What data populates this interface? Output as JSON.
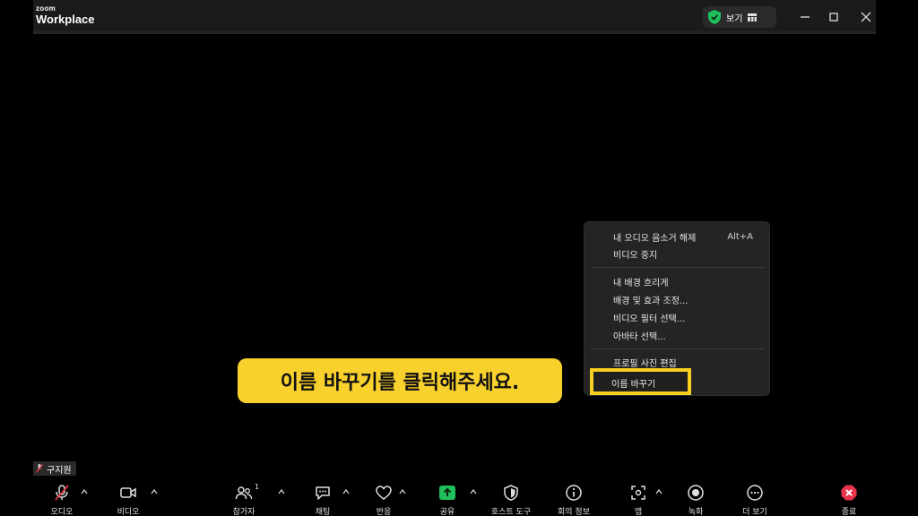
{
  "titlebar": {
    "logo_small": "zoom",
    "logo_big": "Workplace",
    "view_label": "보기",
    "icons": [
      "shield-check-icon",
      "grid-icon",
      "minimize-icon",
      "maximize-icon",
      "close-icon"
    ],
    "shield_color": "#1fbf5b"
  },
  "context_menu": {
    "items": [
      {
        "label": "내 오디오 음소거 해제",
        "shortcut": "Alt+A"
      },
      {
        "label": "비디오 중지"
      },
      {
        "label": "내 배경 흐리게"
      },
      {
        "label": "배경 및 효과 조정..."
      },
      {
        "label": "비디오 필터 선택..."
      },
      {
        "label": "아바타 선택..."
      },
      {
        "label": "프로필 사진 편집"
      },
      {
        "label": "이름 바꾸기"
      }
    ]
  },
  "callout": {
    "text": "이름 바꾸기를 클릭해주세요.",
    "color": "#f9d12c"
  },
  "participant": {
    "name": "구지원"
  },
  "toolbar": {
    "audio": "오디오",
    "video": "비디오",
    "participants": "참가자",
    "participant_count": "1",
    "chat": "채팅",
    "reactions": "반응",
    "share": "공유",
    "host_tools": "호스트 도구",
    "meeting_info": "회의 정보",
    "apps": "앱",
    "record": "녹화",
    "more": "더 보기",
    "end": "종료",
    "share_color": "#1fbf5b",
    "end_color": "#e8334a"
  }
}
